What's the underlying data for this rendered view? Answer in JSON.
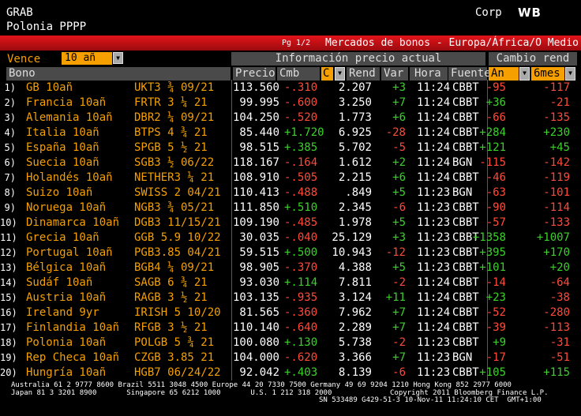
{
  "header": {
    "line1": "GRAB",
    "line2": "Polonia PPPP",
    "corp": "Corp",
    "wb": "WB"
  },
  "title_bar": {
    "page": "Pg 1/2",
    "title": "Mercados de bonos - Europa/África/O Medio"
  },
  "vence": {
    "label": "Vence",
    "value": "10 añ"
  },
  "groups": {
    "info": "Información precio actual",
    "cambio": "Cambio rend"
  },
  "columns": {
    "bono": "Bono",
    "precio": "Precio",
    "cmb": "Cmb",
    "c": "C",
    "rend": "Rend",
    "var": "Var",
    "hora": "Hora",
    "fuente": "Fuente",
    "an": "An",
    "mes": "6mes"
  },
  "colors": {
    "positive": "#3bd12a",
    "negative": "#ff4a3a",
    "accent": "#f5a000",
    "title_bar": "#e4141a"
  },
  "rows": [
    {
      "n": "1)",
      "name": "GB 10añ",
      "tick": "UKT3 ¾ 09/21",
      "price": "113.560",
      "cmb": "-.310",
      "rend": "2.207",
      "var": "+3",
      "hora": "11:24",
      "src": "CBBT",
      "an": "-95",
      "mes": "-117"
    },
    {
      "n": "2)",
      "name": "Francia 10añ",
      "tick": "FRTR 3 ¼ 21",
      "price": "99.995",
      "cmb": "-.600",
      "rend": "3.250",
      "var": "+7",
      "hora": "11:24",
      "src": "CBBT",
      "an": "+36",
      "mes": "-21"
    },
    {
      "n": "3)",
      "name": "Alemania 10añ",
      "tick": "DBR2 ¼ 09/21",
      "price": "104.250",
      "cmb": "-.520",
      "rend": "1.773",
      "var": "+6",
      "hora": "11:24",
      "src": "CBBT",
      "an": "-66",
      "mes": "-135"
    },
    {
      "n": "4)",
      "name": "Italia 10añ",
      "tick": "BTPS 4 ¾ 21",
      "price": "85.440",
      "cmb": "+1.720",
      "rend": "6.925",
      "var": "-28",
      "hora": "11:24",
      "src": "CBBT",
      "an": "+284",
      "mes": "+230"
    },
    {
      "n": "5)",
      "name": "España 10añ",
      "tick": "SPGB 5 ½ 21",
      "price": "98.515",
      "cmb": "+.385",
      "rend": "5.702",
      "var": "-5",
      "hora": "11:24",
      "src": "CBBT",
      "an": "+121",
      "mes": "+45"
    },
    {
      "n": "6)",
      "name": "Suecia 10añ",
      "tick": "SGB3 ½ 06/22",
      "price": "118.167",
      "cmb": "-.164",
      "rend": "1.612",
      "var": "+2",
      "hora": "11:24",
      "src": "BGN",
      "an": "-115",
      "mes": "-142"
    },
    {
      "n": "7)",
      "name": "Holandés 10añ",
      "tick": "NETHER3 ¼ 21",
      "price": "108.910",
      "cmb": "-.505",
      "rend": "2.215",
      "var": "+6",
      "hora": "11:24",
      "src": "CBBT",
      "an": "-46",
      "mes": "-119"
    },
    {
      "n": "8)",
      "name": "Suizo 10añ",
      "tick": "SWISS 2 04/21",
      "price": "110.413",
      "cmb": "-.488",
      "rend": ".849",
      "var": "+5",
      "hora": "11:23",
      "src": "BGN",
      "an": "-63",
      "mes": "-101"
    },
    {
      "n": "9)",
      "name": "Noruega 10añ",
      "tick": "NGB3 ¾ 05/21",
      "price": "111.850",
      "cmb": "+.510",
      "rend": "2.345",
      "var": "-6",
      "hora": "11:23",
      "src": "CBBT",
      "an": "-90",
      "mes": "-114"
    },
    {
      "n": "10)",
      "name": "Dinamarca 10añ",
      "tick": "DGB3 11/15/21",
      "price": "109.190",
      "cmb": "-.485",
      "rend": "1.978",
      "var": "+5",
      "hora": "11:23",
      "src": "CBBT",
      "an": "-57",
      "mes": "-133"
    },
    {
      "n": "11)",
      "name": "Grecia 10añ",
      "tick": "GGB 5.9 10/22",
      "price": "30.035",
      "cmb": "-.040",
      "rend": "25.129",
      "var": "+3",
      "hora": "11:23",
      "src": "CBBT",
      "an": "+1358",
      "mes": "+1007"
    },
    {
      "n": "12)",
      "name": "Portugal 10añ",
      "tick": "PGB3.85 04/21",
      "price": "59.515",
      "cmb": "+.500",
      "rend": "10.943",
      "var": "-12",
      "hora": "11:23",
      "src": "CBBT",
      "an": "+395",
      "mes": "+170"
    },
    {
      "n": "13)",
      "name": "Bélgica 10añ",
      "tick": "BGB4 ¼ 09/21",
      "price": "98.905",
      "cmb": "-.370",
      "rend": "4.388",
      "var": "+5",
      "hora": "11:23",
      "src": "CBBT",
      "an": "+101",
      "mes": "+20"
    },
    {
      "n": "14)",
      "name": "Sudáf 10añ",
      "tick": "SAGB 6 ¾ 21",
      "price": "93.030",
      "cmb": "+.114",
      "rend": "7.811",
      "var": "-2",
      "hora": "11:24",
      "src": "CBBT",
      "an": "-14",
      "mes": "-64"
    },
    {
      "n": "15)",
      "name": "Austria 10añ",
      "tick": "RAGB 3 ½ 21",
      "price": "103.135",
      "cmb": "-.935",
      "rend": "3.124",
      "var": "+11",
      "hora": "11:24",
      "src": "CBBT",
      "an": "+23",
      "mes": "-38"
    },
    {
      "n": "16)",
      "name": "Ireland 9yr",
      "tick": "IRISH 5 10/20",
      "price": "81.565",
      "cmb": "-.360",
      "rend": "7.962",
      "var": "+7",
      "hora": "11:24",
      "src": "CBBT",
      "an": "-52",
      "mes": "-280"
    },
    {
      "n": "17)",
      "name": "Finlandia 10añ",
      "tick": "RFGB 3 ½ 21",
      "price": "110.140",
      "cmb": "-.640",
      "rend": "2.289",
      "var": "+7",
      "hora": "11:24",
      "src": "CBBT",
      "an": "-39",
      "mes": "-113"
    },
    {
      "n": "18)",
      "name": "Polonia 10añ",
      "tick": "POLGB 5 ¾ 21",
      "price": "100.080",
      "cmb": "+.130",
      "rend": "5.738",
      "var": "-2",
      "hora": "11:23",
      "src": "CBBT",
      "an": "+9",
      "mes": "-31"
    },
    {
      "n": "19)",
      "name": "Rep Checa 10añ",
      "tick": "CZGB 3.85 21",
      "price": "104.000",
      "cmb": "-.620",
      "rend": "3.366",
      "var": "+7",
      "hora": "11:23",
      "src": "BGN",
      "an": "-17",
      "mes": "-51"
    },
    {
      "n": "20)",
      "name": "Hungría 10añ",
      "tick": "HGB7 06/24/22",
      "price": "92.042",
      "cmb": "+.403",
      "rend": "8.139",
      "var": "-6",
      "hora": "11:23",
      "src": "CBBT",
      "an": "+105",
      "mes": "+115"
    }
  ],
  "footer": {
    "line1": "Australia 61 2 9777 8600 Brazil 5511 3048 4500 Europe 44 20 7330 7500 Germany 49 69 9204 1210 Hong Kong 852 2977 6000",
    "line2": "Japan 81 3 3201 8900       Singapore 65 6212 1000       U.S. 1 212 318 2000",
    "line2r": "Copyright 2011 Bloomberg Finance L.P.",
    "line3r": "SN 533489 G429-51-3 10-Nov-11 11:24:10 CET  GMT+1:00"
  }
}
